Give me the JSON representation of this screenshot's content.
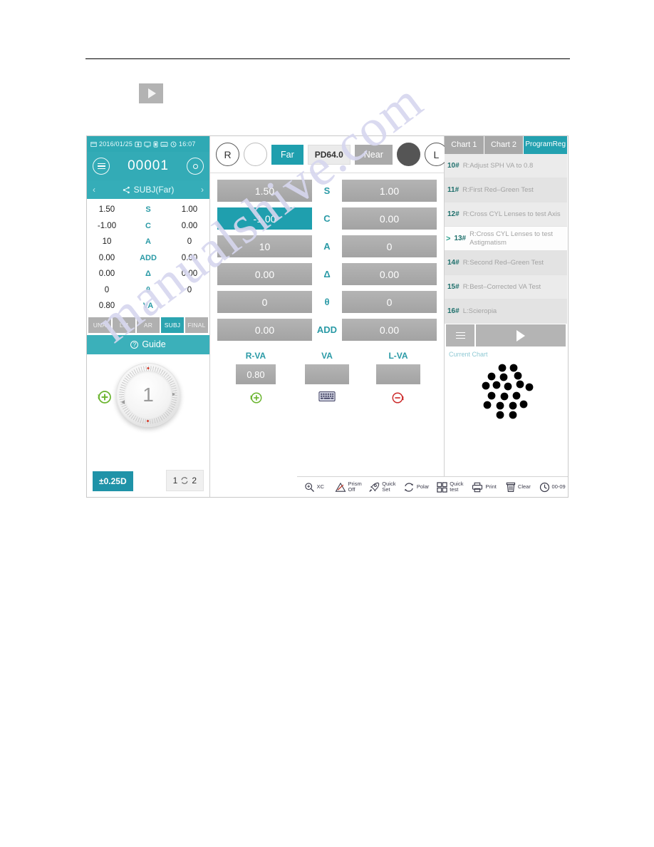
{
  "page": {
    "watermark": "manualshive.com",
    "play_icon": "play-icon"
  },
  "device": {
    "status": {
      "date": "2016/01/25",
      "time": "16:07",
      "icons": [
        "calendar-icon",
        "projector-icon",
        "monitor-icon",
        "battery-icon",
        "screen-icon",
        "clock-icon"
      ]
    },
    "patient": {
      "id": "00001",
      "menu_icon": "hamburger-menu-icon",
      "settings_icon": "gear-icon"
    },
    "subj_bar": {
      "prev": "‹",
      "title": "SUBJ(Far)",
      "next": "›",
      "share_icon": "share-icon"
    },
    "measure_table": {
      "rows": [
        {
          "left": "1.50",
          "label": "S",
          "right": "1.00"
        },
        {
          "left": "-1.00",
          "label": "C",
          "right": "0.00"
        },
        {
          "left": "10",
          "label": "A",
          "right": "0"
        },
        {
          "left": "0.00",
          "label": "ADD",
          "right": "0.00"
        },
        {
          "left": "0.00",
          "label": "Δ",
          "right": "0.00"
        },
        {
          "left": "0",
          "label": "θ",
          "right": "0"
        },
        {
          "left": "0.80",
          "label": "VA",
          "right": ""
        }
      ]
    },
    "mode_tabs": [
      {
        "label": "UNA",
        "active": false
      },
      {
        "label": "LM",
        "active": false
      },
      {
        "label": "AR",
        "active": false
      },
      {
        "label": "SUBJ",
        "active": true
      },
      {
        "label": "FINAL",
        "active": false
      }
    ],
    "guide": {
      "label": "Guide",
      "icon": "help-circle-icon"
    },
    "dial": {
      "value": "1",
      "plus_icon": "rotate-plus-icon",
      "step_label": "±0.25D",
      "swap_left": "1",
      "swap_right": "2",
      "swap_icon": "swap-icon"
    },
    "eye_bar": {
      "right_eye": "R",
      "blank_circle": "",
      "far_label": "Far",
      "pd_label": "PD64.0",
      "near_label": "Near",
      "occluded": "",
      "left_eye": "L"
    },
    "value_rows": [
      {
        "left": "1.50",
        "label": "S",
        "right": "1.00",
        "left_selected": false
      },
      {
        "left": "-1.00",
        "label": "C",
        "right": "0.00",
        "left_selected": true
      },
      {
        "left": "10",
        "label": "A",
        "right": "0",
        "left_selected": false
      },
      {
        "left": "0.00",
        "label": "Δ",
        "right": "0.00",
        "left_selected": false
      },
      {
        "left": "0",
        "label": "θ",
        "right": "0",
        "left_selected": false
      },
      {
        "left": "0.00",
        "label": "ADD",
        "right": "0.00",
        "left_selected": false
      }
    ],
    "va_row": {
      "r_head": "R-VA",
      "r_value": "0.80",
      "c_head": "VA",
      "c_value": "",
      "l_head": "L-VA",
      "l_value": "",
      "plus_icon": "va-increase-icon",
      "keyboard_icon": "keyboard-icon",
      "minus_icon": "va-decrease-icon"
    },
    "chart_tabs": [
      {
        "label": "Chart 1",
        "active": false
      },
      {
        "label": "Chart 2",
        "active": false
      },
      {
        "label": "ProgramReg",
        "active": true
      }
    ],
    "program_list": [
      {
        "num": "10#",
        "text": "R:Adjust SPH VA to 0.8",
        "active": false
      },
      {
        "num": "11#",
        "text": "R:First Red–Green Test",
        "active": false
      },
      {
        "num": "12#",
        "text": "R:Cross CYL Lenses to test Axis",
        "active": false
      },
      {
        "num": "13#",
        "text": "R:Cross CYL Lenses to test Astigmatism",
        "active": true
      },
      {
        "num": "14#",
        "text": "R:Second Red–Green Test",
        "active": false
      },
      {
        "num": "15#",
        "text": "R:Best–Corrected VA Test",
        "active": false
      },
      {
        "num": "16#",
        "text": "L:Scieropia",
        "active": false
      }
    ],
    "program_controls": {
      "menu_icon": "list-menu-icon",
      "play_icon": "play-icon"
    },
    "current_chart": {
      "title": "Current Chart",
      "pattern": "dot-cluster-chart"
    },
    "toolbar": [
      {
        "icon": "cross-cylinder-icon",
        "label": "XC"
      },
      {
        "icon": "prism-icon",
        "label": "Prism\nOff"
      },
      {
        "icon": "rocket-icon",
        "label": "Quick\nSet"
      },
      {
        "icon": "polar-icon",
        "label": "Polar"
      },
      {
        "icon": "grid-icon",
        "label": "Quick\ntest"
      },
      {
        "icon": "printer-icon",
        "label": "Print"
      },
      {
        "icon": "trash-icon",
        "label": "Clear"
      },
      {
        "icon": "clock-icon",
        "label": "00-09"
      }
    ]
  },
  "colors": {
    "teal": "#2fa9b4",
    "teal_dark": "#1f9fae",
    "gray_btn": "#aaaaaa",
    "label_teal": "#2a9aa6"
  }
}
